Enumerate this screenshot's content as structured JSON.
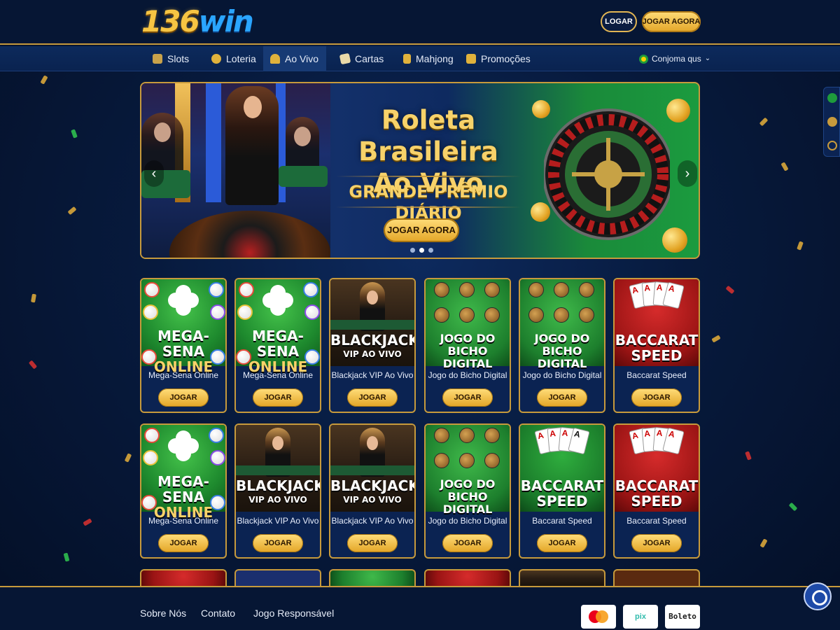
{
  "header": {
    "logo_num": "136",
    "logo_word": "win",
    "login_label": "LOGAR",
    "play_label": "JOGAR AGORA"
  },
  "nav": {
    "items": [
      {
        "label": "Slots",
        "icon": "slot-machine-icon"
      },
      {
        "label": "Loteria",
        "icon": "lottery-ball-icon"
      },
      {
        "label": "Ao Vivo",
        "icon": "live-dealer-icon",
        "active": true
      },
      {
        "label": "Cartas",
        "icon": "cards-icon"
      },
      {
        "label": "Mahjong",
        "icon": "mahjong-tile-icon"
      },
      {
        "label": "Promoções",
        "icon": "gift-icon"
      }
    ],
    "language": "Conjoma qus"
  },
  "banner": {
    "title_line1": "Roleta Brasileira",
    "title_line2": "Ao Vivo",
    "subtitle": "GRANDE PRÊMIO DIÁRIO",
    "button": "JOGAR AGORA",
    "prev_icon": "‹",
    "next_icon": "›",
    "slides": 3,
    "active_slide": 2
  },
  "games": {
    "play_label": "JOGAR",
    "row1": [
      {
        "name": "Mega-Sena Online",
        "t1": "MEGA-SENA",
        "t2": "ONLINE",
        "kind": "mega"
      },
      {
        "name": "Mega-Sena Online",
        "t1": "MEGA-SENA",
        "t2": "ONLINE",
        "kind": "mega"
      },
      {
        "name": "Blackjack VIP Ao Vivo",
        "t1": "BLACKJACK",
        "t2": "VIP AO VIVO",
        "kind": "bj"
      },
      {
        "name": "Jogo do Bicho Digital",
        "t1": "JOGO DO BICHO",
        "t2": "DIGITAL",
        "kind": "bicho"
      },
      {
        "name": "Jogo do Bicho Digital",
        "t1": "JOGO DO BICHO",
        "t2": "DIGITAL",
        "kind": "bicho"
      },
      {
        "name": "Baccarat Speed",
        "t1": "BACCARAT",
        "t2": "SPEED",
        "kind": "bac"
      }
    ],
    "row2": [
      {
        "name": "Mega-Sena Online",
        "t1": "MEGA-SENA",
        "t2": "ONLINE",
        "kind": "mega"
      },
      {
        "name": "Blackjack VIP Ao Vivo",
        "t1": "BLACKJACK",
        "t2": "VIP AO VIVO",
        "kind": "bj"
      },
      {
        "name": "Blackjack VIP Ao Vivo",
        "t1": "BLACKJACK",
        "t2": "VIP AO VIVO",
        "kind": "bj"
      },
      {
        "name": "Jogo do Bicho Digital",
        "t1": "JOGO DO BICHO",
        "t2": "DIGITAL",
        "kind": "bicho"
      },
      {
        "name": "Baccarat Speed",
        "t1": "BACCARAT",
        "t2": "SPEED",
        "kind": "bacg"
      },
      {
        "name": "Baccarat Speed",
        "t1": "BACCARAT",
        "t2": "SPEED",
        "kind": "bac"
      }
    ]
  },
  "footer": {
    "links": [
      "Sobre Nós",
      "Contato",
      "Jogo Responsável"
    ],
    "payments": [
      "mastercard",
      "pix",
      "Boleto"
    ]
  },
  "colors": {
    "gold": "#c79a3c",
    "navy": "#061634",
    "button_gold": "#e3a526"
  }
}
